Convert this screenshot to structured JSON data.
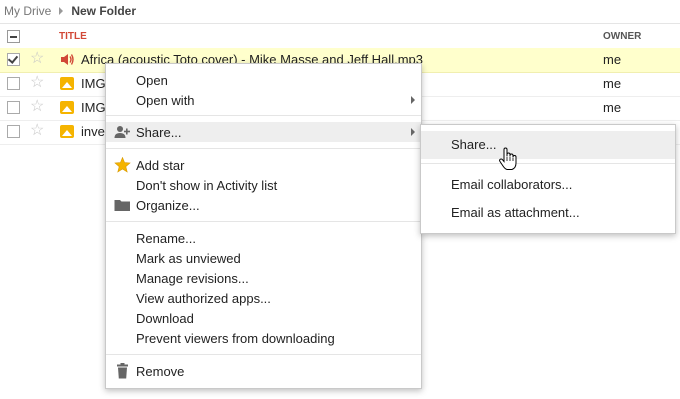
{
  "breadcrumb": {
    "root": "My Drive",
    "current": "New Folder"
  },
  "list": {
    "columns": {
      "title": "TITLE",
      "owner": "OWNER"
    },
    "rows": [
      {
        "name": "Africa (acoustic Toto cover) - Mike Masse and Jeff Hall.mp3",
        "owner": "me",
        "type": "audio",
        "selected": true
      },
      {
        "name": "IMG",
        "owner": "me",
        "type": "image",
        "selected": false
      },
      {
        "name": "IMG",
        "owner": "me",
        "type": "image",
        "selected": false
      },
      {
        "name": "inver",
        "owner": "",
        "type": "image",
        "selected": false
      }
    ]
  },
  "context_menu": {
    "open": "Open",
    "open_with": "Open with",
    "share": "Share...",
    "add_star": "Add star",
    "dont_show_activity": "Don't show in Activity list",
    "organize": "Organize...",
    "rename": "Rename...",
    "mark_unviewed": "Mark as unviewed",
    "manage_revisions": "Manage revisions...",
    "view_authorized_apps": "View authorized apps...",
    "download": "Download",
    "prevent_download": "Prevent viewers from downloading",
    "remove": "Remove"
  },
  "share_submenu": {
    "share": "Share...",
    "email_collaborators": "Email collaborators...",
    "email_attachment": "Email as attachment..."
  },
  "colors": {
    "title_header": "#d14836",
    "selected_row": "#ffffcc",
    "star_active": "#f5b400",
    "audio_icon": "#d14836"
  }
}
